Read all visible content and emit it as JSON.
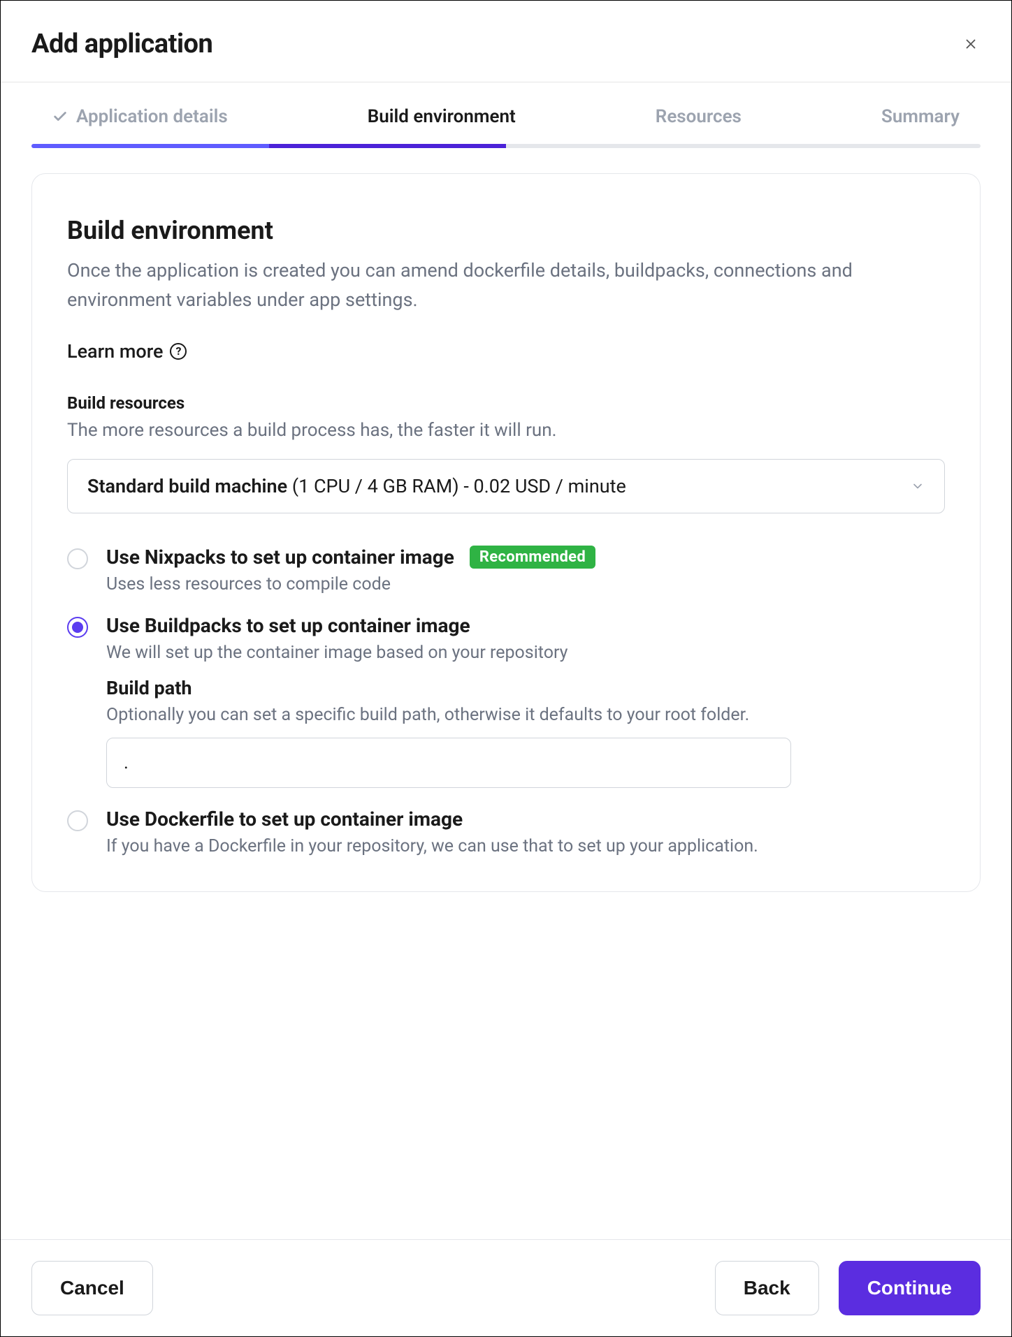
{
  "header": {
    "title": "Add application"
  },
  "steps": {
    "s1": "Application details",
    "s2": "Build environment",
    "s3": "Resources",
    "s4": "Summary"
  },
  "section": {
    "title": "Build environment",
    "desc": "Once the application is created you can amend dockerfile details, buildpacks, connections and environment variables under app settings.",
    "learn_more": "Learn more"
  },
  "build_resources": {
    "title": "Build resources",
    "desc": "The more resources a build process has, the faster it will run.",
    "select_bold": "Standard build machine ",
    "select_rest": "(1 CPU / 4 GB RAM) - 0.02 USD / minute"
  },
  "options": {
    "nixpacks": {
      "title": "Use Nixpacks to set up container image",
      "badge": "Recommended",
      "desc": "Uses less resources to compile code"
    },
    "buildpacks": {
      "title": "Use Buildpacks to set up container image",
      "desc": "We will set up the container image based on your repository",
      "path_title": "Build path",
      "path_desc": "Optionally you can set a specific build path, otherwise it defaults to your root folder.",
      "path_value": "."
    },
    "dockerfile": {
      "title": "Use Dockerfile to set up container image",
      "desc": "If you have a Dockerfile in your repository, we can use that to set up your application."
    }
  },
  "footer": {
    "cancel": "Cancel",
    "back": "Back",
    "continue": "Continue"
  }
}
